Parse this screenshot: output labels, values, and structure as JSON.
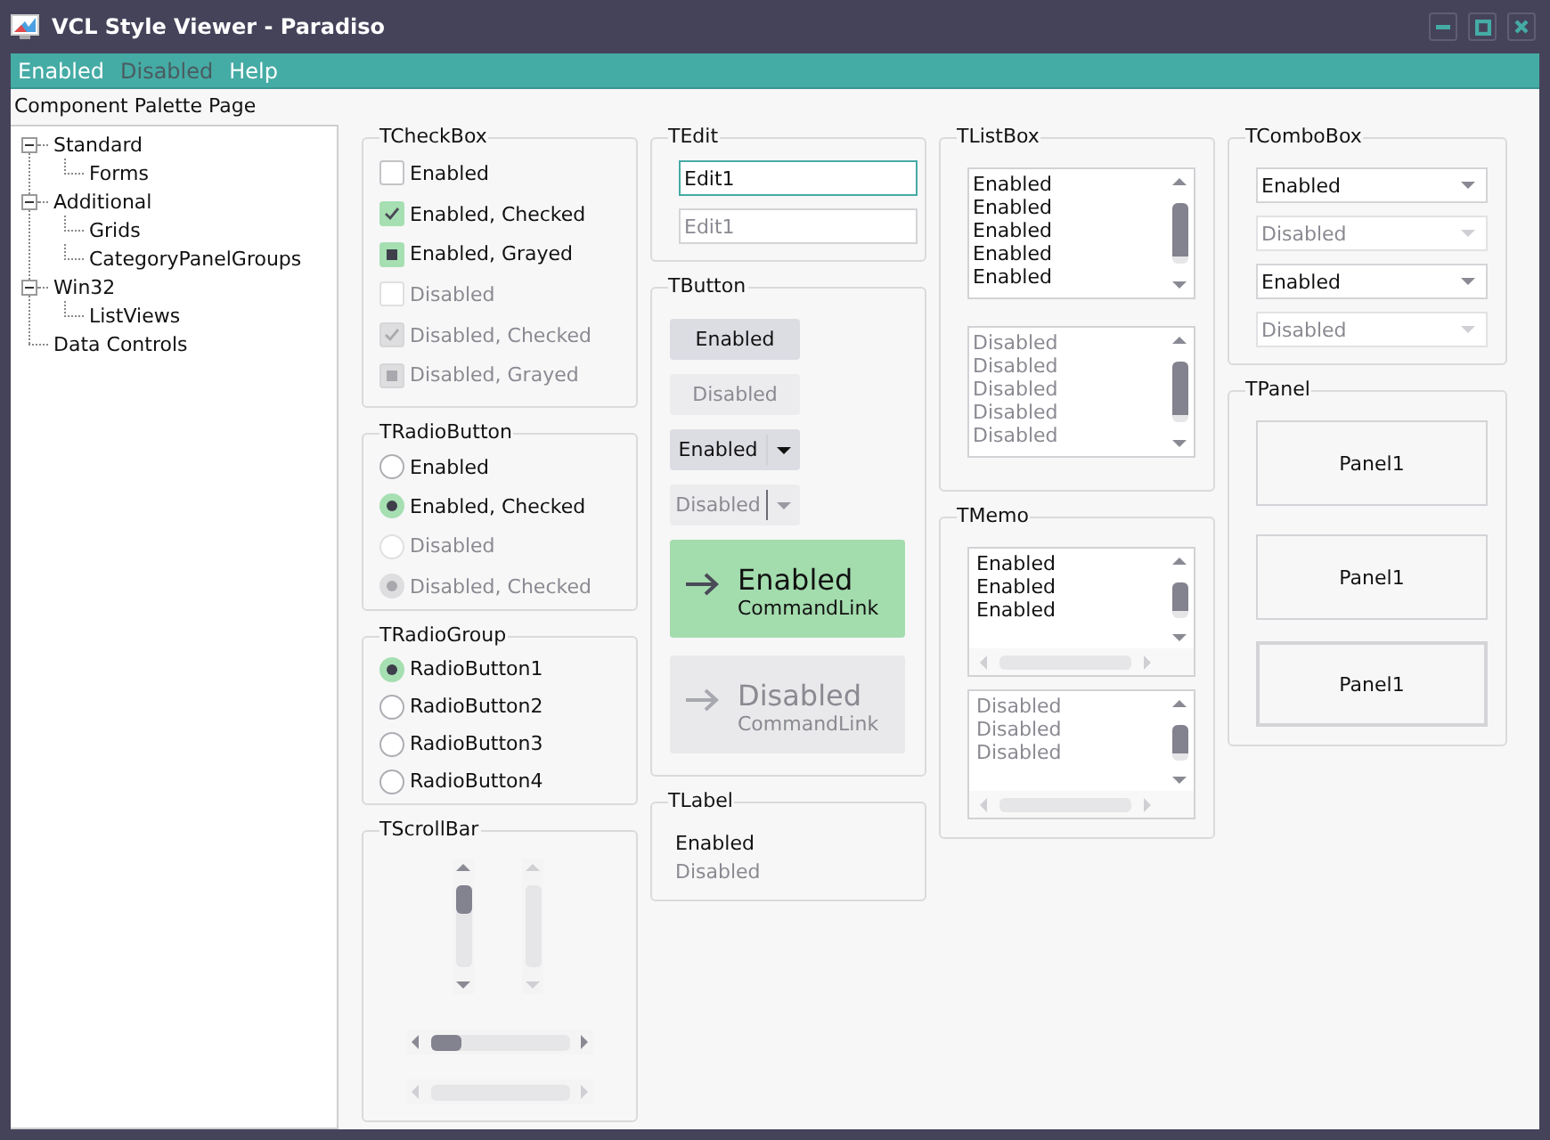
{
  "window": {
    "title": "VCL Style Viewer - Paradiso"
  },
  "menu": [
    {
      "label": "Enabled",
      "disabled": false
    },
    {
      "label": "Disabled",
      "disabled": true
    },
    {
      "label": "Help",
      "disabled": false
    }
  ],
  "palette_label": "Component Palette Page",
  "tree": [
    {
      "label": "Standard",
      "expanded": true,
      "children": [
        {
          "label": "Forms"
        }
      ]
    },
    {
      "label": "Additional",
      "expanded": true,
      "children": [
        {
          "label": "Grids"
        },
        {
          "label": "CategoryPanelGroups"
        }
      ]
    },
    {
      "label": "Win32",
      "expanded": true,
      "children": [
        {
          "label": "ListViews"
        }
      ]
    },
    {
      "label": "Data Controls"
    }
  ],
  "checkboxes": {
    "title": "TCheckBox",
    "items": [
      {
        "label": "Enabled",
        "checked": false,
        "grayed": false,
        "disabled": false
      },
      {
        "label": "Enabled, Checked",
        "checked": true,
        "grayed": false,
        "disabled": false
      },
      {
        "label": "Enabled, Grayed",
        "checked": true,
        "grayed": true,
        "disabled": false
      },
      {
        "label": "Disabled",
        "checked": false,
        "grayed": false,
        "disabled": true
      },
      {
        "label": "Disabled, Checked",
        "checked": true,
        "grayed": false,
        "disabled": true
      },
      {
        "label": "Disabled, Grayed",
        "checked": true,
        "grayed": true,
        "disabled": true
      }
    ]
  },
  "radio_buttons": {
    "title": "TRadioButton",
    "items": [
      {
        "label": "Enabled",
        "checked": false,
        "disabled": false
      },
      {
        "label": "Enabled, Checked",
        "checked": true,
        "disabled": false
      },
      {
        "label": "Disabled",
        "checked": false,
        "disabled": true
      },
      {
        "label": "Disabled, Checked",
        "checked": true,
        "disabled": true
      }
    ]
  },
  "radio_group": {
    "title": "TRadioGroup",
    "items": [
      {
        "label": "RadioButton1",
        "selected": true
      },
      {
        "label": "RadioButton2",
        "selected": false
      },
      {
        "label": "RadioButton3",
        "selected": false
      },
      {
        "label": "RadioButton4",
        "selected": false
      }
    ]
  },
  "scrollbars": {
    "title": "TScrollBar",
    "items": [
      {
        "kind": "vertical",
        "disabled": false
      },
      {
        "kind": "vertical",
        "disabled": true
      },
      {
        "kind": "horizontal",
        "disabled": false
      },
      {
        "kind": "horizontal",
        "disabled": true
      }
    ]
  },
  "edit": {
    "title": "TEdit",
    "fields": [
      {
        "value": "Edit1",
        "focused": true,
        "disabled": false
      },
      {
        "value": "Edit1",
        "focused": false,
        "disabled": true
      }
    ]
  },
  "buttons": {
    "title": "TButton",
    "items": [
      {
        "kind": "push",
        "label": "Enabled",
        "disabled": false
      },
      {
        "kind": "push",
        "label": "Disabled",
        "disabled": true
      },
      {
        "kind": "split",
        "label": "Enabled",
        "disabled": false
      },
      {
        "kind": "split",
        "label": "Disabled",
        "disabled": true
      },
      {
        "kind": "command_link",
        "label": "Enabled",
        "note": "CommandLink",
        "disabled": false
      },
      {
        "kind": "command_link",
        "label": "Disabled",
        "note": "CommandLink",
        "disabled": true
      }
    ]
  },
  "label": {
    "title": "TLabel",
    "items": [
      {
        "text": "Enabled",
        "disabled": false
      },
      {
        "text": "Disabled",
        "disabled": true
      }
    ]
  },
  "listbox": {
    "title": "TListBox",
    "lists": [
      {
        "items": [
          "Enabled",
          "Enabled",
          "Enabled",
          "Enabled",
          "Enabled"
        ],
        "disabled": false
      },
      {
        "items": [
          "Disabled",
          "Disabled",
          "Disabled",
          "Disabled",
          "Disabled"
        ],
        "disabled": true
      }
    ]
  },
  "memo": {
    "title": "TMemo",
    "memos": [
      {
        "lines": [
          "Enabled",
          "Enabled",
          "Enabled"
        ],
        "disabled": false
      },
      {
        "lines": [
          "Disabled",
          "Disabled",
          "Disabled"
        ],
        "disabled": true
      }
    ]
  },
  "combobox": {
    "title": "TComboBox",
    "items": [
      {
        "value": "Enabled",
        "disabled": false
      },
      {
        "value": "Disabled",
        "disabled": true
      },
      {
        "value": "Enabled",
        "disabled": false
      },
      {
        "value": "Disabled",
        "disabled": true
      }
    ]
  },
  "panel": {
    "title": "TPanel",
    "panels": [
      {
        "label": "Panel1",
        "kind": "flat"
      },
      {
        "label": "Panel1",
        "kind": "flat"
      },
      {
        "label": "Panel1",
        "kind": "framed"
      }
    ]
  }
}
